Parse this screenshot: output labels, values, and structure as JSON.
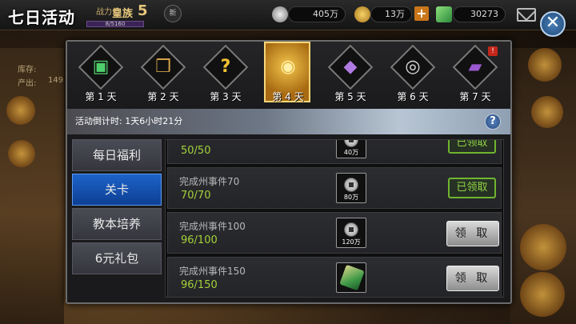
{
  "header": {
    "title": "七日活动",
    "vip_label": "战力值",
    "vip_rank": "皇族",
    "vip_level": "5",
    "vip_progress": "8/5160",
    "new_icon_label": "新"
  },
  "currencies": {
    "silver": "405万",
    "gold": "13万",
    "gems": "30273"
  },
  "side_labels": {
    "stock": "库存:",
    "output": "产出:",
    "output_value": "149"
  },
  "days": [
    {
      "label": "第 1 天",
      "icon": "jade-seal-icon"
    },
    {
      "label": "第 2 天",
      "icon": "scroll-icon"
    },
    {
      "label": "第 3 天",
      "icon": "mystery-scroll-icon"
    },
    {
      "label": "第 4 天",
      "icon": "gold-coin-icon",
      "active": true
    },
    {
      "label": "第 5 天",
      "icon": "purple-ore-icon"
    },
    {
      "label": "第 6 天",
      "icon": "silver-coin-icon"
    },
    {
      "label": "第 7 天",
      "icon": "purple-book-icon",
      "badge": "!"
    }
  ],
  "countdown": "活动倒计时: 1天6小时21分",
  "help_label": "?",
  "tabs": [
    {
      "label": "每日福利"
    },
    {
      "label": "关卡",
      "active": true
    },
    {
      "label": "教本培养"
    },
    {
      "label": "6元礼包"
    }
  ],
  "tasks": [
    {
      "name": "",
      "progress": "50/50",
      "reward_icon": "silver-coin-icon",
      "reward_qty": "40万",
      "status": "claimed",
      "status_label": "已领取"
    },
    {
      "name": "完成州事件70",
      "progress": "70/70",
      "reward_icon": "silver-coin-icon",
      "reward_qty": "80万",
      "status": "claimed",
      "status_label": "已领取"
    },
    {
      "name": "完成州事件100",
      "progress": "96/100",
      "reward_icon": "silver-coin-icon",
      "reward_qty": "120万",
      "status": "claim",
      "status_label": "领 取"
    },
    {
      "name": "完成州事件150",
      "progress": "96/150",
      "reward_icon": "jade-gem-icon",
      "reward_qty": "",
      "status": "claim",
      "status_label": "领 取"
    }
  ],
  "colors": {
    "progress_green": "#a3d13a",
    "active_tab_blue": "#1d63c9",
    "claimed_green": "#8fd443"
  }
}
